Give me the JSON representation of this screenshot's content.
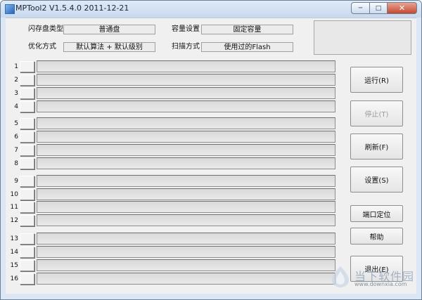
{
  "window": {
    "title": "MPTool2 V1.5.4.0 2011-12-21",
    "controls": {
      "minimize": "─",
      "maximize": "□",
      "close": "✕"
    }
  },
  "settings": {
    "flash_type_label": "闪存盘类型",
    "flash_type_value": "普通盘",
    "capacity_label": "容量设置",
    "capacity_value": "固定容量",
    "optimize_label": "优化方式",
    "optimize_value": "默认算法 + 默认级别",
    "scan_label": "扫描方式",
    "scan_value": "使用过的Flash"
  },
  "ports": [
    {
      "num": "1"
    },
    {
      "num": "2"
    },
    {
      "num": "3"
    },
    {
      "num": "4"
    },
    {
      "num": "5"
    },
    {
      "num": "6"
    },
    {
      "num": "7"
    },
    {
      "num": "8"
    },
    {
      "num": "9"
    },
    {
      "num": "10"
    },
    {
      "num": "11"
    },
    {
      "num": "12"
    },
    {
      "num": "13"
    },
    {
      "num": "14"
    },
    {
      "num": "15"
    },
    {
      "num": "16"
    }
  ],
  "buttons": {
    "run": "运行(R)",
    "stop": "停止(T)",
    "refresh": "刷新(F)",
    "setup": "设置(S)",
    "port_locate": "端口定位",
    "help": "帮助",
    "exit": "退出(E)"
  },
  "watermark": {
    "text": "当下软件园",
    "url": "www.downxia.com"
  }
}
